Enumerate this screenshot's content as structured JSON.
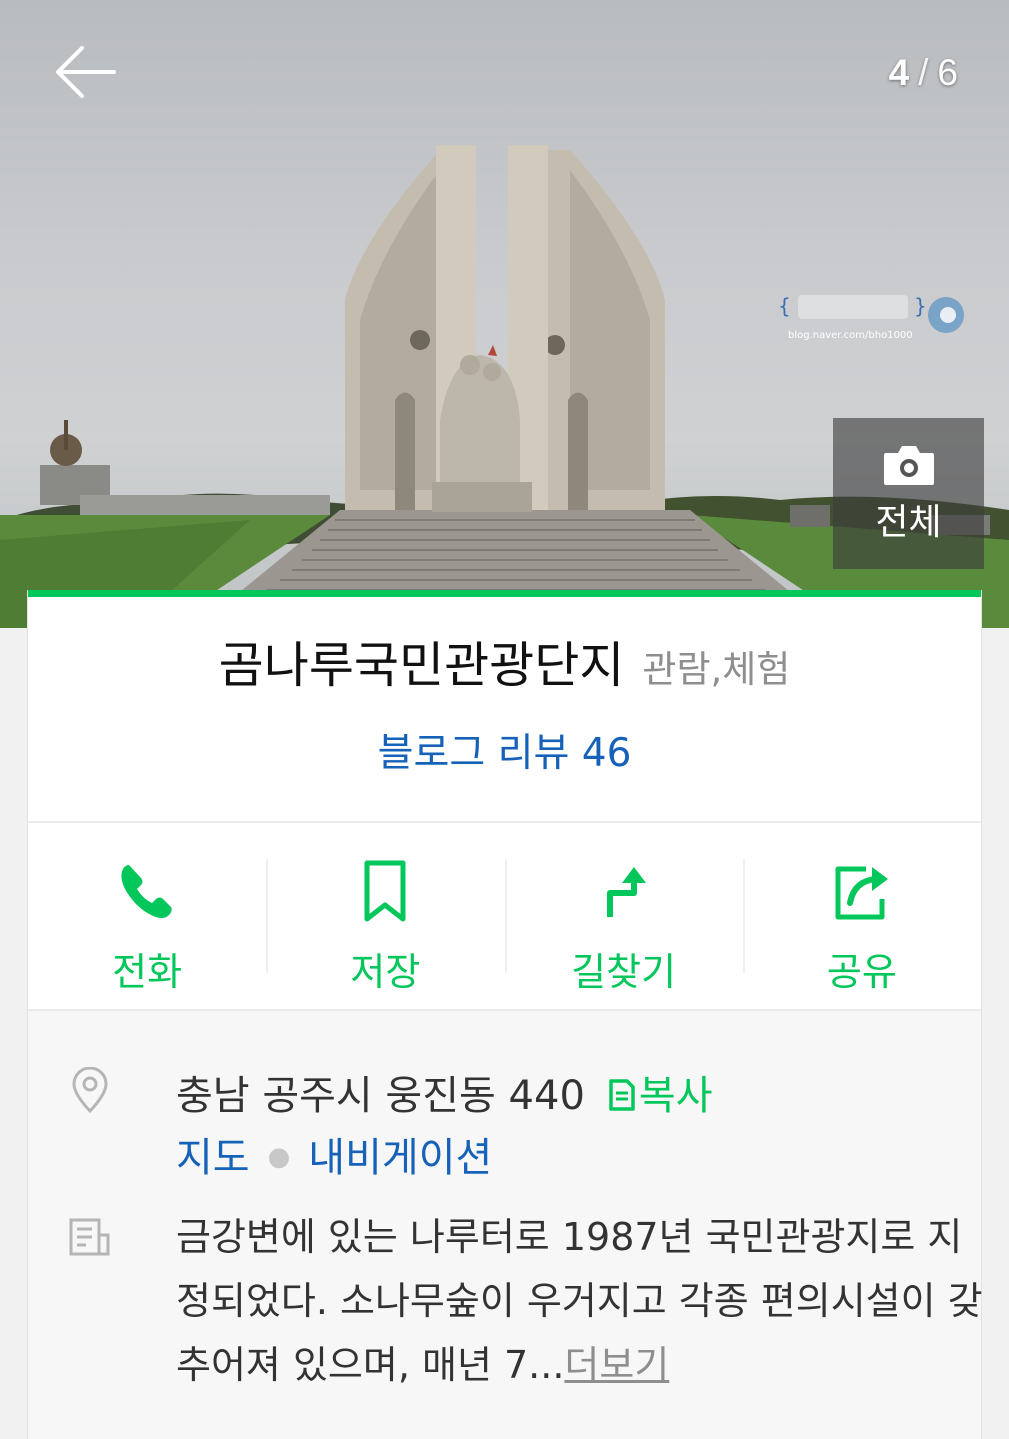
{
  "hero": {
    "current_index": "4",
    "separator": "/",
    "total": "6",
    "all_photos_label": "전체",
    "watermark_url": "blog.naver.com/bho1000"
  },
  "place": {
    "name": "곰나루국민관광단지",
    "category": "관람,체험",
    "review_link": "블로그 리뷰 46"
  },
  "actions": [
    {
      "id": "call",
      "label": "전화",
      "icon": "phone-icon"
    },
    {
      "id": "save",
      "label": "저장",
      "icon": "bookmark-icon"
    },
    {
      "id": "directions",
      "label": "길찾기",
      "icon": "directions-icon"
    },
    {
      "id": "share",
      "label": "공유",
      "icon": "share-icon"
    }
  ],
  "info": {
    "address": "충남 공주시 웅진동 440",
    "copy_label": "복사",
    "map_link": "지도",
    "navigation_link": "내비게이션",
    "description": "금강변에 있는 나루터로 1987년 국민관광지로 지정되었다. 소나무숲이 우거지고 각종 편의시설이 갖추어져 있으며, 매년 7...",
    "more_label": "더보기"
  },
  "colors": {
    "accent_green": "#03c75a",
    "link_blue": "#1662b8",
    "muted_gray": "#8e8e8e"
  }
}
